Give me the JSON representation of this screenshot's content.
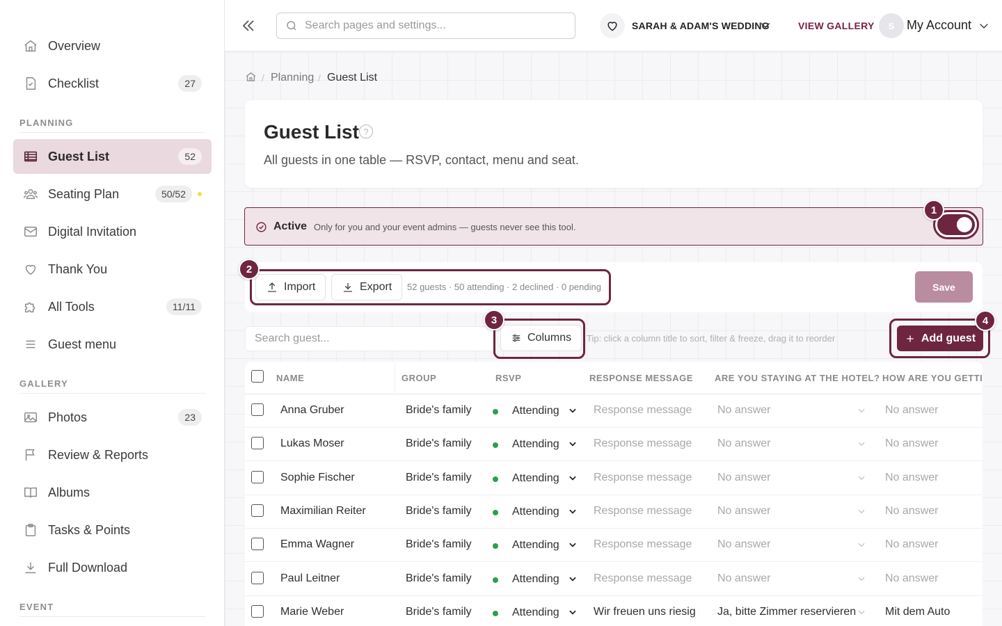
{
  "sidebar": {
    "items": [
      {
        "label": "Overview"
      },
      {
        "label": "Checklist",
        "badge": "27"
      },
      {
        "label": "Guest List",
        "badge": "52"
      },
      {
        "label": "Seating Plan",
        "badge": "50/52"
      },
      {
        "label": "Digital Invitation"
      },
      {
        "label": "Thank You"
      },
      {
        "label": "All Tools",
        "badge": "11/11"
      },
      {
        "label": "Guest menu"
      },
      {
        "label": "Photos",
        "badge": "23"
      },
      {
        "label": "Review & Reports"
      },
      {
        "label": "Albums"
      },
      {
        "label": "Tasks & Points"
      },
      {
        "label": "Full Download"
      }
    ],
    "sections": {
      "planning": "PLANNING",
      "gallery": "GALLERY",
      "event": "EVENT"
    }
  },
  "topbar": {
    "search_placeholder": "Search pages and settings...",
    "event_name": "SARAH & ADAM'S WEDDING",
    "view_gallery": "VIEW GALLERY",
    "avatar_initial": "S",
    "account": "My Account"
  },
  "breadcrumb": {
    "parent": "Planning",
    "current": "Guest List"
  },
  "page": {
    "title": "Guest List",
    "subtitle": "All guests in one table — RSVP, contact, menu and seat."
  },
  "status": {
    "label": "Active",
    "description": "Only for you and your event admins — guests never see this tool.",
    "toggle_on": true
  },
  "toolbar": {
    "import": "Import",
    "export": "Export",
    "stats": "52 guests · 50 attending · 2 declined · 0 pending",
    "save": "Save",
    "search_placeholder": "Search guest...",
    "columns": "Columns",
    "tip": "Tip: click a column title to sort, filter & freeze, drag it to reorder",
    "add_guest": "Add guest"
  },
  "markers": [
    "1",
    "2",
    "3",
    "4"
  ],
  "table": {
    "columns": [
      "NAME",
      "GROUP",
      "RSVP",
      "RESPONSE MESSAGE",
      "ARE YOU STAYING AT THE HOTEL?",
      "HOW ARE YOU GETTIN"
    ],
    "rows": [
      {
        "name": "Anna Gruber",
        "group": "Bride's family",
        "rsvp": "Attending",
        "message": "Response message",
        "hotel": "No answer",
        "travel": "No answer"
      },
      {
        "name": "Lukas Moser",
        "group": "Bride's family",
        "rsvp": "Attending",
        "message": "Response message",
        "hotel": "No answer",
        "travel": "No answer"
      },
      {
        "name": "Sophie Fischer",
        "group": "Bride's family",
        "rsvp": "Attending",
        "message": "Response message",
        "hotel": "No answer",
        "travel": "No answer"
      },
      {
        "name": "Maximilian Reiter",
        "group": "Bride's family",
        "rsvp": "Attending",
        "message": "Response message",
        "hotel": "No answer",
        "travel": "No answer"
      },
      {
        "name": "Emma Wagner",
        "group": "Bride's family",
        "rsvp": "Attending",
        "message": "Response message",
        "hotel": "No answer",
        "travel": "No answer"
      },
      {
        "name": "Paul Leitner",
        "group": "Bride's family",
        "rsvp": "Attending",
        "message": "Response message",
        "hotel": "No answer",
        "travel": "No answer"
      },
      {
        "name": "Marie Weber",
        "group": "Bride's family",
        "rsvp": "Attending",
        "message": "Wir freuen uns riesig a",
        "hotel": "Ja, bitte Zimmer reservieren",
        "travel": "Mit dem Auto"
      }
    ]
  },
  "colors": {
    "brand": "#6e2540",
    "active_bg": "#ead9df",
    "save_disabled": "#b98ca0",
    "rsvp_attending": "#2e9e4f",
    "seating_dot": "#f2de3a"
  },
  "icons": [
    "home-icon",
    "checklist-icon",
    "table-icon",
    "people-icon",
    "envelope-icon",
    "heart-icon",
    "puzzle-icon",
    "menu-icon",
    "image-icon",
    "flag-icon",
    "book-icon",
    "clipboard-icon",
    "download-icon",
    "search-icon",
    "upload-icon",
    "sliders-icon",
    "plus-icon",
    "chevron-down-icon",
    "double-chevron-left-icon",
    "help-icon",
    "check-circle-icon"
  ]
}
